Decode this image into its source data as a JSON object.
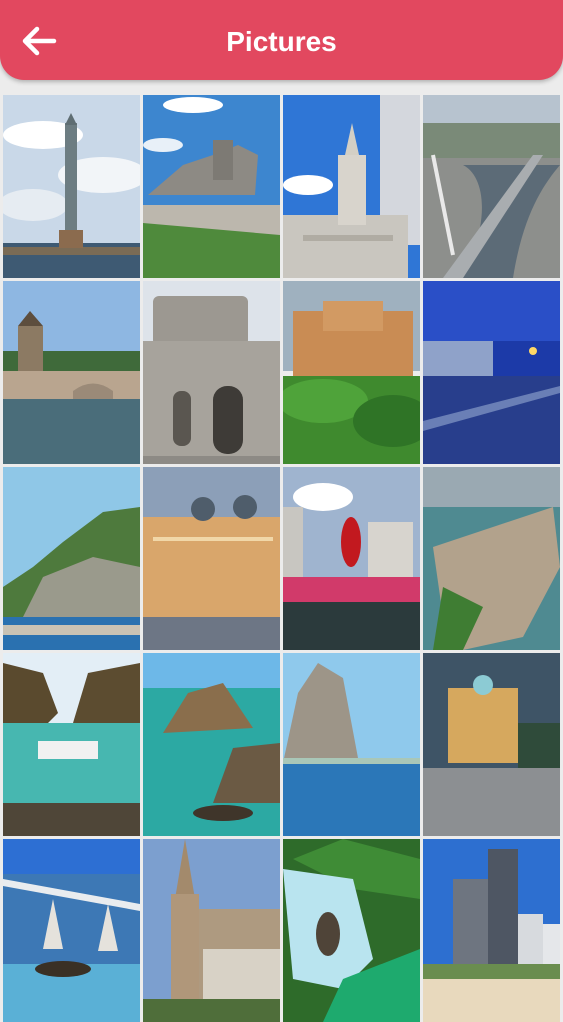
{
  "header": {
    "title": "Pictures",
    "back_icon": "arrow-left-icon",
    "background": "#e2485f"
  },
  "gallery": {
    "photos": [
      {
        "name": "photo-sword-monument-tower"
      },
      {
        "name": "photo-bandeiras-monument"
      },
      {
        "name": "photo-temple-skyscraper"
      },
      {
        "name": "photo-cable-bridge-aerial"
      },
      {
        "name": "photo-canal-tower-village"
      },
      {
        "name": "photo-stone-rotunda-church"
      },
      {
        "name": "photo-ornate-building-garden"
      },
      {
        "name": "photo-waterfront-promenade-night"
      },
      {
        "name": "photo-cliff-coast"
      },
      {
        "name": "photo-domed-palace-illuminated"
      },
      {
        "name": "photo-rooster-sculpture-bridge"
      },
      {
        "name": "photo-aerial-peninsula-city"
      },
      {
        "name": "photo-boat-cove"
      },
      {
        "name": "photo-sea-rocks-island"
      },
      {
        "name": "photo-rock-pinnacle-sea"
      },
      {
        "name": "photo-lit-palace-plaza"
      },
      {
        "name": "photo-modern-palace-sculpture"
      },
      {
        "name": "photo-gothic-church"
      },
      {
        "name": "photo-waterfall"
      },
      {
        "name": "photo-beach-skyscrapers"
      }
    ]
  }
}
